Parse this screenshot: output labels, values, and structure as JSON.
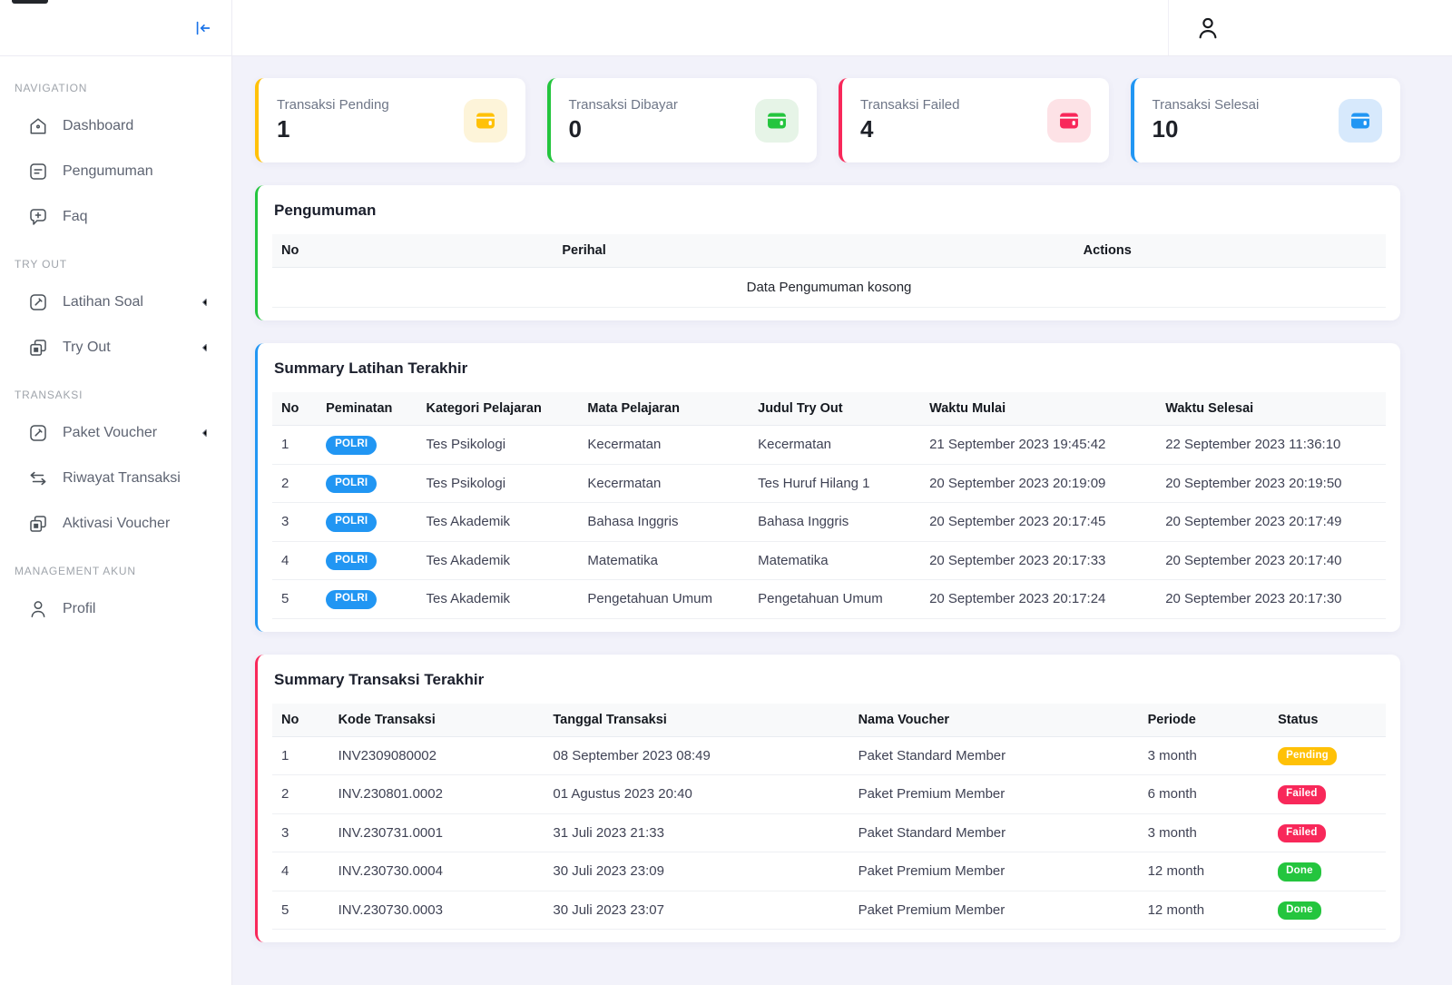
{
  "sidebar": {
    "collapse_icon": "collapse-left-icon",
    "sections": [
      {
        "label": "NAVIGATION",
        "items": [
          {
            "label": "Dashboard",
            "icon": "home-icon",
            "chevron": false
          },
          {
            "label": "Pengumuman",
            "icon": "note-icon",
            "chevron": false
          },
          {
            "label": "Faq",
            "icon": "faq-bubble-icon",
            "chevron": false
          }
        ]
      },
      {
        "label": "TRY OUT",
        "items": [
          {
            "label": "Latihan Soal",
            "icon": "edit-square-icon",
            "chevron": true
          },
          {
            "label": "Try Out",
            "icon": "copy-icon",
            "chevron": true
          }
        ]
      },
      {
        "label": "TRANSAKSI",
        "items": [
          {
            "label": "Paket Voucher",
            "icon": "edit-square-icon",
            "chevron": true
          },
          {
            "label": "Riwayat Transaksi",
            "icon": "swap-icon",
            "chevron": false
          },
          {
            "label": "Aktivasi Voucher",
            "icon": "copy-icon",
            "chevron": false
          }
        ]
      },
      {
        "label": "MANAGEMENT AKUN",
        "items": [
          {
            "label": "Profil",
            "icon": "person-icon",
            "chevron": false
          }
        ]
      }
    ]
  },
  "topbar": {
    "user_icon": "person-icon"
  },
  "stats": {
    "cards": [
      {
        "label": "Transaksi Pending",
        "value": "1",
        "icon": "wallet-icon",
        "color": "#FFC107",
        "tint": "#FDF4D9"
      },
      {
        "label": "Transaksi Dibayar",
        "value": "0",
        "icon": "wallet-icon",
        "color": "#24C53E",
        "tint": "#E6F4E7"
      },
      {
        "label": "Transaksi Failed",
        "value": "4",
        "icon": "wallet-icon",
        "color": "#F8285A",
        "tint": "#FDE2E6"
      },
      {
        "label": "Transaksi Selesai",
        "value": "10",
        "icon": "wallet-icon",
        "color": "#2196F3",
        "tint": "#D7E9FC"
      }
    ]
  },
  "announcements": {
    "title": "Pengumuman",
    "accent": "#24C53E",
    "columns": [
      "No",
      "Perihal",
      "Actions"
    ],
    "empty_text": "Data Pengumuman kosong"
  },
  "latihan_summary": {
    "title": "Summary Latihan Terakhir",
    "accent": "#2196F3",
    "badge_color": "#2196F3",
    "columns": [
      "No",
      "Peminatan",
      "Kategori Pelajaran",
      "Mata Pelajaran",
      "Judul Try Out",
      "Waktu Mulai",
      "Waktu Selesai"
    ],
    "rows": [
      {
        "no": "1",
        "peminatan": "POLRI",
        "kategori": "Tes Psikologi",
        "mata": "Kecermatan",
        "judul": "Kecermatan",
        "mulai": "21 September 2023 19:45:42",
        "selesai": "22 September 2023 11:36:10"
      },
      {
        "no": "2",
        "peminatan": "POLRI",
        "kategori": "Tes Psikologi",
        "mata": "Kecermatan",
        "judul": "Tes Huruf Hilang 1",
        "mulai": "20 September 2023 20:19:09",
        "selesai": "20 September 2023 20:19:50"
      },
      {
        "no": "3",
        "peminatan": "POLRI",
        "kategori": "Tes Akademik",
        "mata": "Bahasa Inggris",
        "judul": "Bahasa Inggris",
        "mulai": "20 September 2023 20:17:45",
        "selesai": "20 September 2023 20:17:49"
      },
      {
        "no": "4",
        "peminatan": "POLRI",
        "kategori": "Tes Akademik",
        "mata": "Matematika",
        "judul": "Matematika",
        "mulai": "20 September 2023 20:17:33",
        "selesai": "20 September 2023 20:17:40"
      },
      {
        "no": "5",
        "peminatan": "POLRI",
        "kategori": "Tes Akademik",
        "mata": "Pengetahuan Umum",
        "judul": "Pengetahuan Umum",
        "mulai": "20 September 2023 20:17:24",
        "selesai": "20 September 2023 20:17:30"
      }
    ]
  },
  "transaksi_summary": {
    "title": "Summary Transaksi Terakhir",
    "accent": "#F8285A",
    "columns": [
      "No",
      "Kode Transaksi",
      "Tanggal Transaksi",
      "Nama Voucher",
      "Periode",
      "Status"
    ],
    "status_colors": {
      "Pending": "#FFC107",
      "Failed": "#F8285A",
      "Done": "#24C53E"
    },
    "rows": [
      {
        "no": "1",
        "kode": "INV2309080002",
        "tanggal": "08 September 2023 08:49",
        "voucher": "Paket Standard Member",
        "periode": "3 month",
        "status": "Pending"
      },
      {
        "no": "2",
        "kode": "INV.230801.0002",
        "tanggal": "01 Agustus 2023 20:40",
        "voucher": "Paket Premium Member",
        "periode": "6 month",
        "status": "Failed"
      },
      {
        "no": "3",
        "kode": "INV.230731.0001",
        "tanggal": "31 Juli 2023 21:33",
        "voucher": "Paket Standard Member",
        "periode": "3 month",
        "status": "Failed"
      },
      {
        "no": "4",
        "kode": "INV.230730.0004",
        "tanggal": "30 Juli 2023 23:09",
        "voucher": "Paket Premium Member",
        "periode": "12 month",
        "status": "Done"
      },
      {
        "no": "5",
        "kode": "INV.230730.0003",
        "tanggal": "30 Juli 2023 23:07",
        "voucher": "Paket Premium Member",
        "periode": "12 month",
        "status": "Done"
      }
    ]
  }
}
